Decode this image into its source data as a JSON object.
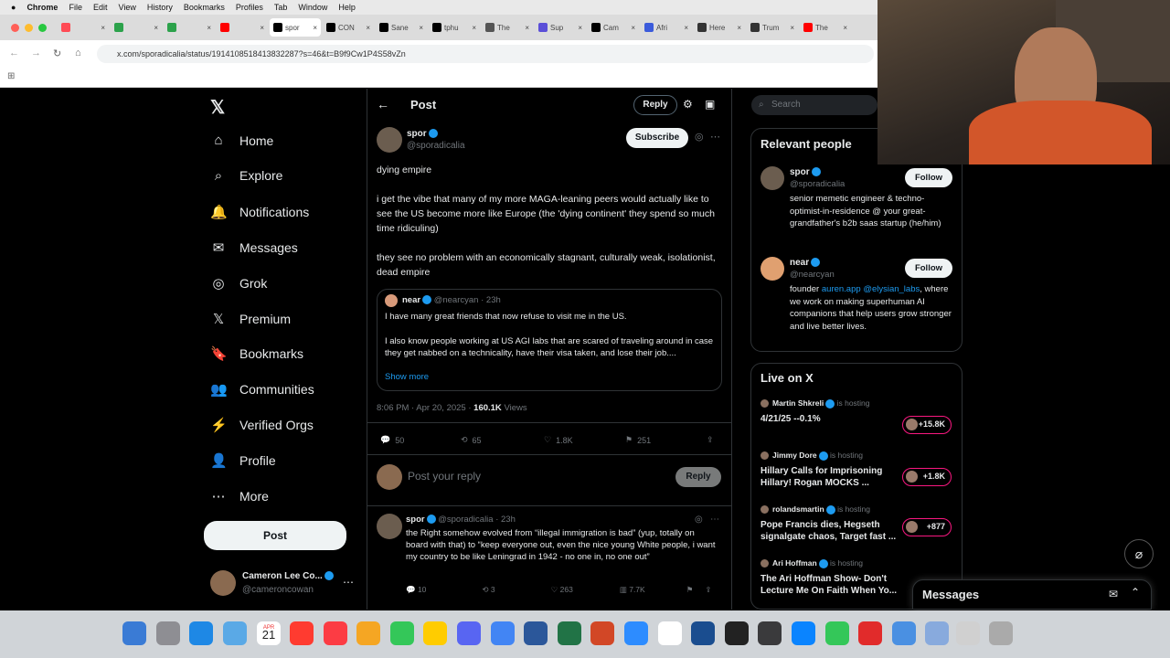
{
  "mac_menu": {
    "apple": "",
    "app": "Chrome",
    "items": [
      "File",
      "Edit",
      "View",
      "History",
      "Bookmarks",
      "Profiles",
      "Tab",
      "Window",
      "Help"
    ]
  },
  "tabs": [
    {
      "label": "",
      "color": "#ff4b55"
    },
    {
      "label": "",
      "color": "#2ca24b"
    },
    {
      "label": "",
      "color": "#2ca24b"
    },
    {
      "label": "",
      "color": "#ff0000"
    },
    {
      "label": "spor",
      "color": "#000"
    },
    {
      "label": "CON",
      "color": "#000"
    },
    {
      "label": "Sane",
      "color": "#000"
    },
    {
      "label": "tphu",
      "color": "#000"
    },
    {
      "label": "The",
      "color": "#555"
    },
    {
      "label": "Sup",
      "color": "#5b4fd8"
    },
    {
      "label": "Cam",
      "color": "#000"
    },
    {
      "label": "Afri",
      "color": "#3b5bdb"
    },
    {
      "label": "Here",
      "color": "#333"
    },
    {
      "label": "Trum",
      "color": "#333"
    },
    {
      "label": "The",
      "color": "#ff0000"
    }
  ],
  "address": {
    "url": "x.com/sporadicalia/status/1914108518413832287?s=46&t=B9f9Cw1P4S58vZn"
  },
  "nav": {
    "items": [
      {
        "label": "Home",
        "icon": "home-icon",
        "glyph": "⌂"
      },
      {
        "label": "Explore",
        "icon": "search-icon",
        "glyph": "⌕"
      },
      {
        "label": "Notifications",
        "icon": "bell-icon",
        "glyph": "🔔"
      },
      {
        "label": "Messages",
        "icon": "mail-icon",
        "glyph": "✉"
      },
      {
        "label": "Grok",
        "icon": "grok-icon",
        "glyph": "◎"
      },
      {
        "label": "Premium",
        "icon": "x-icon",
        "glyph": "𝕏"
      },
      {
        "label": "Bookmarks",
        "icon": "bookmark-icon",
        "glyph": "🔖"
      },
      {
        "label": "Communities",
        "icon": "people-icon",
        "glyph": "👥"
      },
      {
        "label": "Verified Orgs",
        "icon": "bolt-icon",
        "glyph": "⚡"
      },
      {
        "label": "Profile",
        "icon": "person-icon",
        "glyph": "👤"
      },
      {
        "label": "More",
        "icon": "more-icon",
        "glyph": "⋯"
      }
    ],
    "post_button": "Post",
    "account": {
      "name": "Cameron Lee Co...",
      "handle": "@cameroncowan"
    }
  },
  "header": {
    "title": "Post",
    "reply_button": "Reply"
  },
  "post": {
    "name": "spor",
    "handle": "@sporadicalia",
    "subscribe": "Subscribe",
    "p1": "dying empire",
    "p2": "i get the vibe that many of my more MAGA-leaning peers would actually like to see the US become more like Europe (the 'dying continent' they spend so much time ridiculing)",
    "p3": "they see no problem with an economically stagnant, culturally weak, isolationist, dead empire",
    "quote": {
      "name": "near",
      "handle": "@nearcyan",
      "time": "23h",
      "line1": "I have many great friends that now refuse to visit me in the US.",
      "line2": "I also know people working at US AGI labs that are scared of traveling around in case they get nabbed on a technicality, have their visa taken, and lose their job....",
      "show_more": "Show more"
    },
    "meta": {
      "time": "8:06 PM · Apr 20, 2025 ·",
      "views": "160.1K",
      "views_label": "Views"
    },
    "stats": {
      "replies": "50",
      "reposts": "65",
      "likes": "1.8K",
      "bookmarks": "251"
    }
  },
  "reply_box": {
    "placeholder": "Post your reply",
    "button": "Reply"
  },
  "reply": {
    "name": "spor",
    "handle": "@sporadicalia · 23h",
    "text": "the Right somehow evolved from “illegal immigration is bad” (yup, totally on board with that) to “keep everyone out, even the nice young White people, i want my country to be like Leningrad in 1942 - no one in, no one out”",
    "replies": "10",
    "reposts": "3",
    "likes": "263",
    "views": "7.7K"
  },
  "search": {
    "placeholder": "Search"
  },
  "relevant": {
    "title": "Relevant people",
    "people": [
      {
        "name": "spor",
        "handle": "@sporadicalia",
        "follow": "Follow",
        "bio": "senior memetic engineer & techno-optimist-in-residence @ your great-grandfather's b2b saas startup (he/him)"
      },
      {
        "name": "near",
        "handle": "@nearcyan",
        "follow": "Follow",
        "bio_pre": "founder ",
        "link1": "auren.app",
        "link2": "@elysian_labs",
        "bio_post": ", where we work on making superhuman AI companions that help users grow stronger and live better lives."
      }
    ]
  },
  "live": {
    "title": "Live on X",
    "hosting": "is hosting",
    "items": [
      {
        "host": "Martin Shkreli",
        "title": "4/21/25 --0.1%",
        "count": "+15.8K"
      },
      {
        "host": "Jimmy Dore",
        "title": "Hillary Calls for Imprisoning Hillary! Rogan MOCKS ...",
        "count": "+1.8K"
      },
      {
        "host": "rolandsmartin",
        "title": "Pope Francis dies, Hegseth signalgate chaos, Target fast ...",
        "count": "+877"
      },
      {
        "host": "Ari Hoffman",
        "title": "The Ari Hoffman Show- Don't Lecture Me On Faith When Yo...",
        "count": ""
      }
    ]
  },
  "messages_drawer": {
    "title": "Messages"
  },
  "dock": {
    "date_day": "21",
    "date_month": "APR"
  },
  "colors": {
    "accent": "#1d9bf0",
    "live": "#f91880"
  }
}
